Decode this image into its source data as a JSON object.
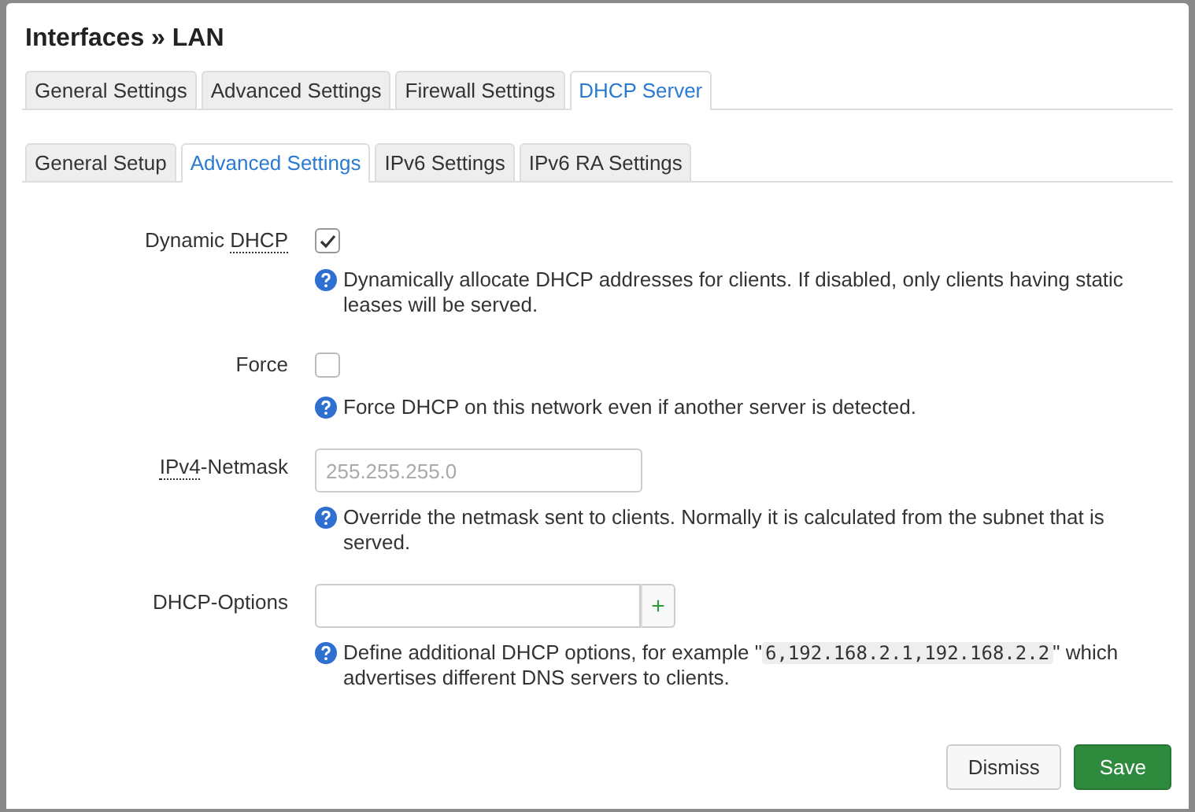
{
  "window": {
    "title": "Interfaces » LAN"
  },
  "tabs": [
    {
      "label": "General Settings",
      "selected": false
    },
    {
      "label": "Advanced Settings",
      "selected": false
    },
    {
      "label": "Firewall Settings",
      "selected": false
    },
    {
      "label": "DHCP Server",
      "selected": true
    }
  ],
  "subtabs": [
    {
      "label": "General Setup",
      "selected": false
    },
    {
      "label": "Advanced Settings",
      "selected": true
    },
    {
      "label": "IPv6 Settings",
      "selected": false
    },
    {
      "label": "IPv6 RA Settings",
      "selected": false
    }
  ],
  "fields": [
    {
      "kind": "checkbox",
      "label": [
        {
          "kind": "text",
          "text": "Dynamic "
        },
        {
          "kind": "abbr",
          "text": "DHCP"
        }
      ],
      "checked": true,
      "help": [
        {
          "kind": "text",
          "text": "Dynamically allocate DHCP addresses for clients. If disabled, only clients having static leases will be served."
        }
      ]
    },
    {
      "kind": "checkbox",
      "label": [
        {
          "kind": "text",
          "text": "Force"
        }
      ],
      "checked": false,
      "help": [
        {
          "kind": "text",
          "text": "Force DHCP on this network even if another server is detected."
        }
      ]
    },
    {
      "kind": "text",
      "label": [
        {
          "kind": "abbr",
          "text": "IPv4"
        },
        {
          "kind": "text",
          "text": "-Netmask"
        }
      ],
      "placeholder": "255.255.255.0",
      "help": [
        {
          "kind": "text",
          "text": "Override the netmask sent to clients. Normally it is calculated from the subnet that is served."
        }
      ]
    },
    {
      "kind": "list",
      "label": [
        {
          "kind": "text",
          "text": "DHCP-Options"
        }
      ],
      "add": "+",
      "help": [
        {
          "kind": "text",
          "text": "Define additional DHCP options, for example \""
        },
        {
          "kind": "code",
          "text": "6,192.168.2.1,192.168.2.2"
        },
        {
          "kind": "text",
          "text": "\" which advertises different DNS servers to clients."
        }
      ]
    }
  ],
  "buttons": [
    {
      "label": "Dismiss",
      "kind": "secondary"
    },
    {
      "label": "Save",
      "kind": "primary"
    }
  ]
}
